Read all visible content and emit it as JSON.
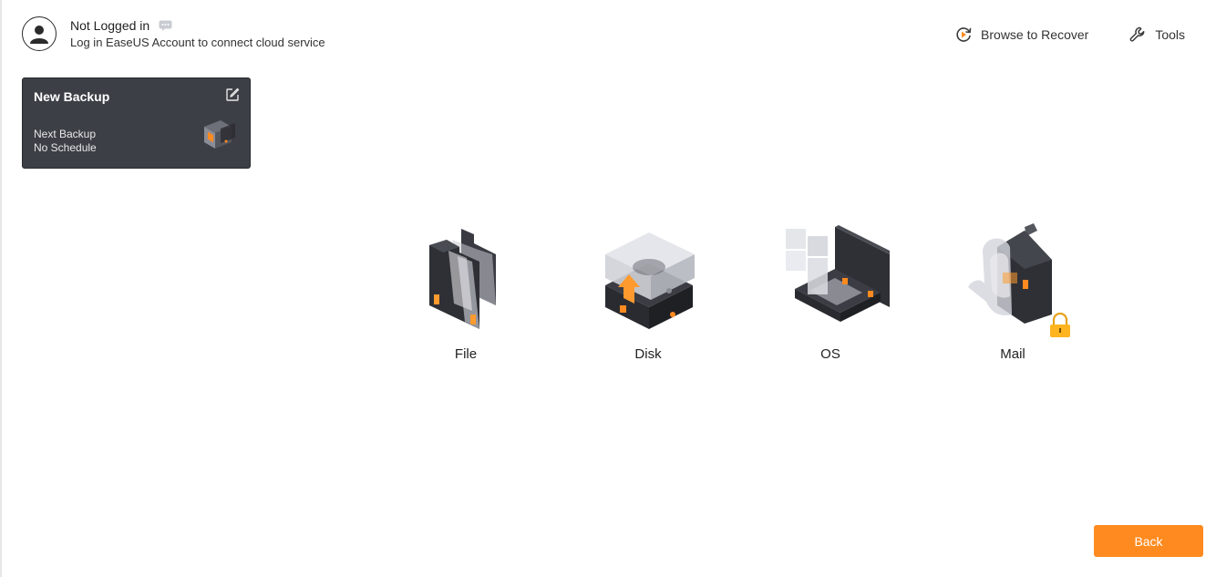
{
  "account": {
    "status": "Not Logged in",
    "prompt": "Log in EaseUS Account to connect cloud service"
  },
  "top_actions": {
    "browse_label": "Browse to Recover",
    "tools_label": "Tools"
  },
  "backup_card": {
    "title": "New Backup",
    "next_label": "Next Backup",
    "schedule_label": "No Schedule"
  },
  "backup_types": [
    {
      "label": "File",
      "icon": "folder-file-icon"
    },
    {
      "label": "Disk",
      "icon": "disk-upload-icon"
    },
    {
      "label": "OS",
      "icon": "os-windows-icon"
    },
    {
      "label": "Mail",
      "icon": "mail-lock-icon"
    }
  ],
  "footer": {
    "back_label": "Back"
  },
  "colors": {
    "accent": "#ff8a1f",
    "card_bg": "#3d3f46",
    "dark_art": "#2f3036"
  }
}
